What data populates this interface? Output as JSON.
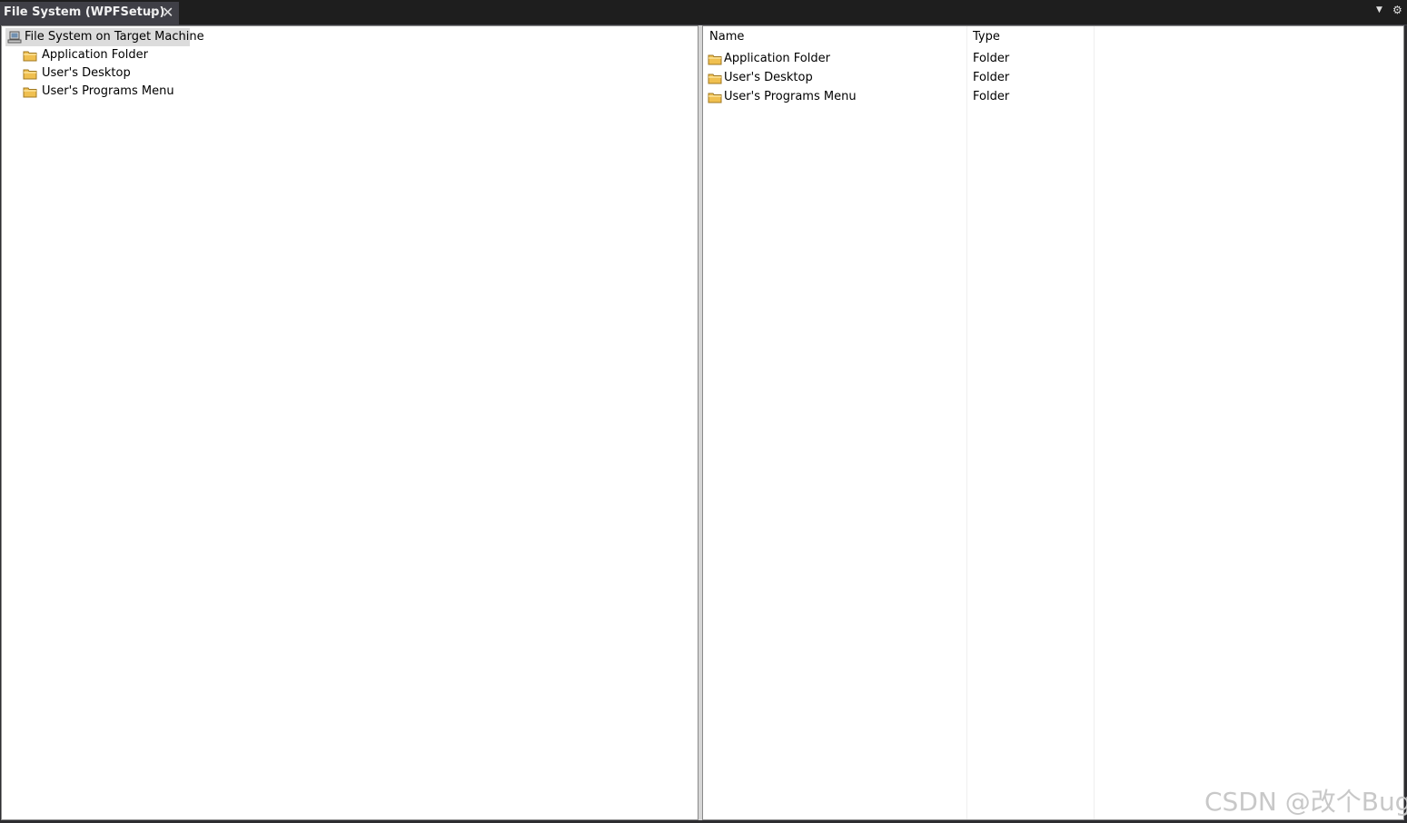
{
  "window": {
    "tab_title": "File System (WPFSetup)",
    "pin_icon": "pin-icon",
    "close_icon": "close-icon",
    "dropdown_icon": "dropdown-icon",
    "gear_icon": "gear-icon"
  },
  "tree": {
    "root": {
      "label": "File System on Target Machine",
      "icon": "computer-icon",
      "selected": true
    },
    "items": [
      {
        "label": "Application Folder",
        "icon": "folder-icon"
      },
      {
        "label": "User's Desktop",
        "icon": "folder-icon"
      },
      {
        "label": "User's Programs Menu",
        "icon": "folder-icon"
      }
    ]
  },
  "list": {
    "columns": [
      "Name",
      "Type"
    ],
    "rows": [
      {
        "name": "Application Folder",
        "type": "Folder",
        "icon": "folder-icon"
      },
      {
        "name": "User's Desktop",
        "type": "Folder",
        "icon": "folder-icon"
      },
      {
        "name": "User's Programs Menu",
        "type": "Folder",
        "icon": "folder-icon"
      }
    ]
  },
  "watermark": "CSDN @改个Bug",
  "colors": {
    "title_bar": "#1e1e1e",
    "tab_active": "#3f3f46",
    "selection": "#dcdcdc",
    "folder": "#f0c050"
  }
}
